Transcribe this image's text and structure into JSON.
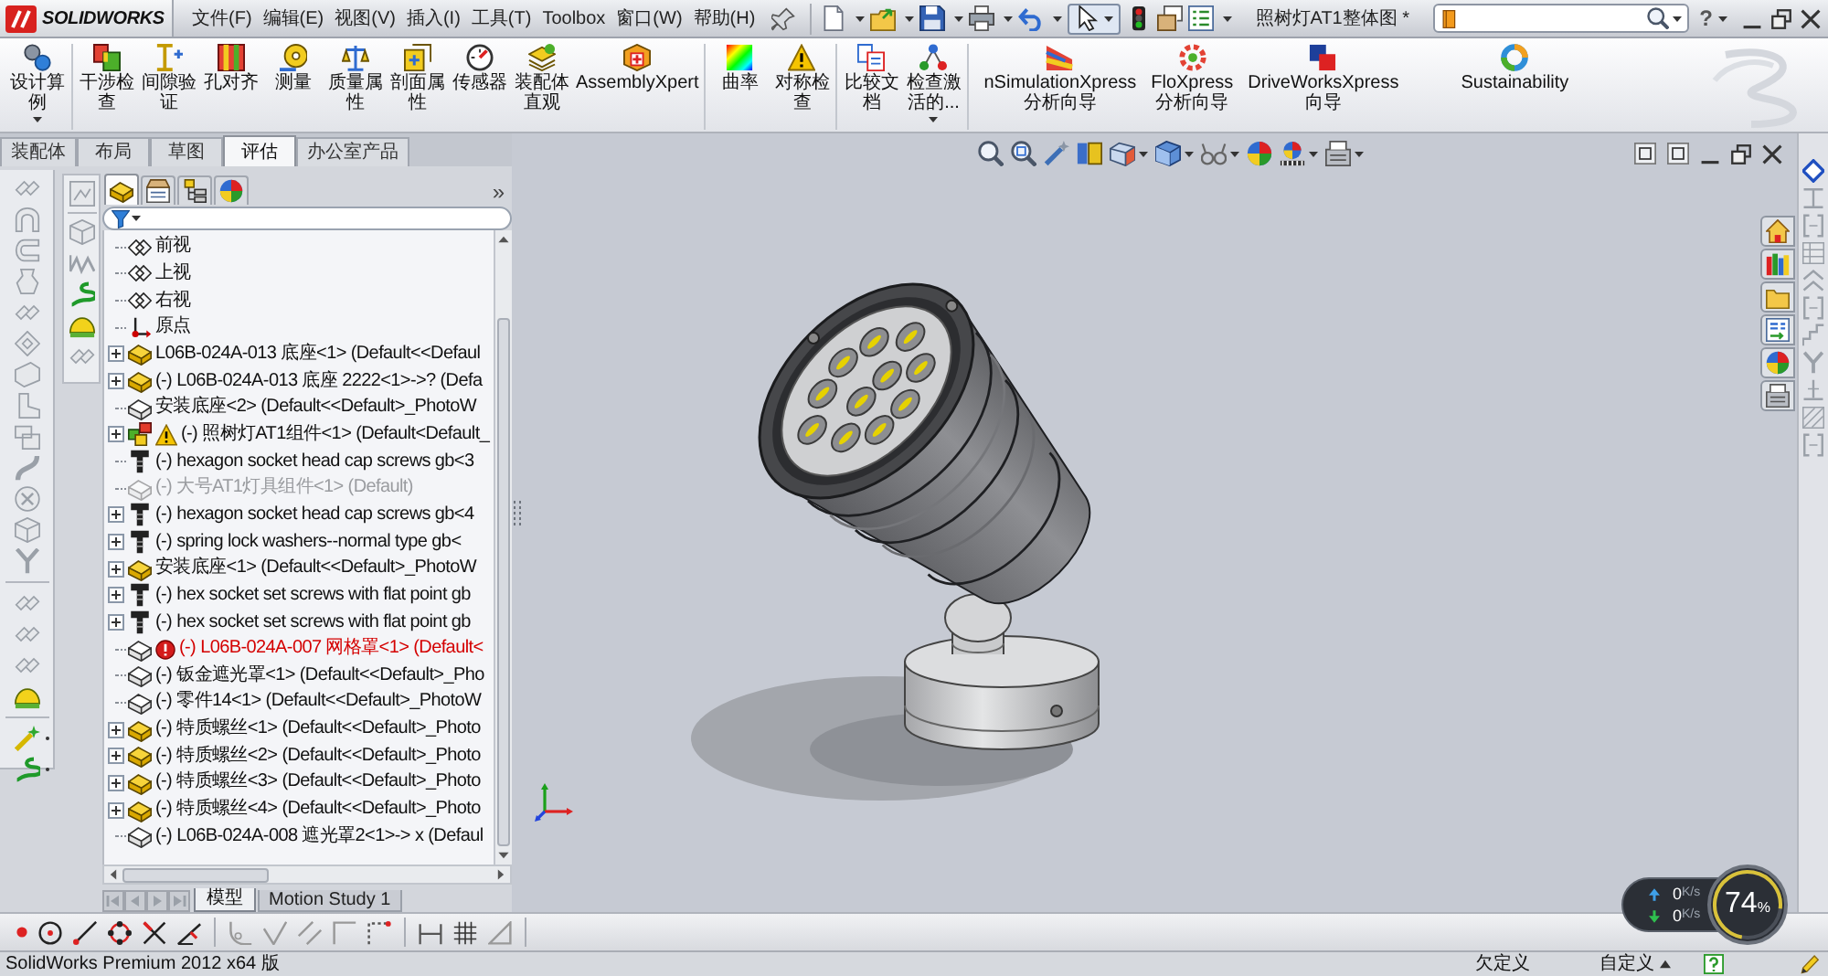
{
  "title_bar": {
    "logo": "SOLIDWORKS",
    "menu": [
      "文件(F)",
      "编辑(E)",
      "视图(V)",
      "插入(I)",
      "工具(T)",
      "Toolbox",
      "窗口(W)",
      "帮助(H)"
    ],
    "select_pressed": true,
    "document_title": "照树灯AT1整体图 *",
    "help": "?"
  },
  "ribbon": {
    "groups": [
      {
        "buttons": [
          {
            "label": "设计算例",
            "dropdown": true
          }
        ]
      },
      {
        "buttons": [
          {
            "label": "干涉检查",
            "dropdown": false
          },
          {
            "label": "间隙验证",
            "dropdown": false
          },
          {
            "label": "孔对齐",
            "dropdown": false
          },
          {
            "label": "测量",
            "dropdown": false
          },
          {
            "label": "质量属性",
            "dropdown": false
          },
          {
            "label": "剖面属性",
            "dropdown": false
          },
          {
            "label": "传感器",
            "dropdown": false
          },
          {
            "label": "装配体直观",
            "dropdown": false
          },
          {
            "label": "AssemblyXpert",
            "dropdown": false
          }
        ]
      },
      {
        "buttons": [
          {
            "label": "曲率",
            "dropdown": false
          },
          {
            "label": "对称检查",
            "dropdown": false
          }
        ]
      },
      {
        "buttons": [
          {
            "label": "比较文档",
            "dropdown": false
          },
          {
            "label": "检查激活的...",
            "dropdown": true
          }
        ]
      },
      {
        "buttons": [
          {
            "label": "nSimulationXpress 分析向导",
            "dropdown": false
          },
          {
            "label": "FloXpress 分析向导",
            "dropdown": false
          },
          {
            "label": "DriveWorksXpress 向导",
            "dropdown": false
          },
          {
            "label": "Sustainability",
            "dropdown": false
          }
        ]
      }
    ]
  },
  "tabs": [
    {
      "label": "装配体",
      "selected": false
    },
    {
      "label": "布局",
      "selected": false
    },
    {
      "label": "草图",
      "selected": false
    },
    {
      "label": "评估",
      "selected": true
    },
    {
      "label": "办公室产品",
      "selected": false
    }
  ],
  "feature_tree": {
    "panel_tabs": [
      {
        "selected": true
      },
      {
        "selected": false
      },
      {
        "selected": false
      },
      {
        "selected": false
      }
    ],
    "expand_toggle": "»",
    "items": [
      {
        "text": "前视",
        "kind": "plane",
        "expandable": false,
        "warning": false,
        "error": false,
        "suppressed": false
      },
      {
        "text": "上视",
        "kind": "plane",
        "expandable": false,
        "warning": false,
        "error": false,
        "suppressed": false
      },
      {
        "text": "右视",
        "kind": "plane",
        "expandable": false,
        "warning": false,
        "error": false,
        "suppressed": false
      },
      {
        "text": "原点",
        "kind": "origin",
        "expandable": false,
        "warning": false,
        "error": false,
        "suppressed": false
      },
      {
        "text": "L06B-024A-013 底座<1> (Default<<Defaul",
        "kind": "assembly",
        "expandable": true,
        "warning": false,
        "error": false,
        "suppressed": false
      },
      {
        "text": "(-) L06B-024A-013 底座 2222<1>->? (Defa",
        "kind": "assembly",
        "expandable": true,
        "warning": false,
        "error": false,
        "suppressed": false
      },
      {
        "text": "安装底座<2> (Default<<Default>_PhotoW",
        "kind": "part",
        "expandable": false,
        "warning": false,
        "error": false,
        "suppressed": false
      },
      {
        "text": "(-) 照树灯AT1组件<1> (Default<Default_",
        "kind": "multi_assembly",
        "expandable": true,
        "warning": true,
        "error": false,
        "suppressed": false
      },
      {
        "text": "(-) hexagon socket head cap screws gb<3",
        "kind": "screw",
        "expandable": false,
        "warning": false,
        "error": false,
        "suppressed": false
      },
      {
        "text": "(-) 大号AT1灯具组件<1> (Default)",
        "kind": "part",
        "expandable": false,
        "warning": false,
        "error": false,
        "suppressed": true
      },
      {
        "text": "(-) hexagon socket head cap screws gb<4",
        "kind": "screw",
        "expandable": true,
        "warning": false,
        "error": false,
        "suppressed": false
      },
      {
        "text": "(-) spring lock washers--normal type gb<",
        "kind": "screw",
        "expandable": true,
        "warning": false,
        "error": false,
        "suppressed": false
      },
      {
        "text": "安装底座<1> (Default<<Default>_PhotoW",
        "kind": "assembly",
        "expandable": true,
        "warning": false,
        "error": false,
        "suppressed": false
      },
      {
        "text": "(-) hex socket set screws with flat point gb",
        "kind": "screw",
        "expandable": true,
        "warning": false,
        "error": false,
        "suppressed": false
      },
      {
        "text": "(-) hex socket set screws with flat point gb",
        "kind": "screw",
        "expandable": true,
        "warning": false,
        "error": false,
        "suppressed": false
      },
      {
        "text": "(-) L06B-024A-007 网格罩<1> (Default<",
        "kind": "part",
        "expandable": false,
        "warning": false,
        "error": true,
        "suppressed": false
      },
      {
        "text": "(-) 钣金遮光罩<1> (Default<<Default>_Pho",
        "kind": "part",
        "expandable": false,
        "warning": false,
        "error": false,
        "suppressed": false
      },
      {
        "text": "(-) 零件14<1> (Default<<Default>_PhotoW",
        "kind": "part",
        "expandable": false,
        "warning": false,
        "error": false,
        "suppressed": false
      },
      {
        "text": "(-) 特质螺丝<1> (Default<<Default>_Photo",
        "kind": "assembly",
        "expandable": true,
        "warning": false,
        "error": false,
        "suppressed": false
      },
      {
        "text": "(-) 特质螺丝<2> (Default<<Default>_Photo",
        "kind": "assembly",
        "expandable": true,
        "warning": false,
        "error": false,
        "suppressed": false
      },
      {
        "text": "(-) 特质螺丝<3> (Default<<Default>_Photo",
        "kind": "assembly",
        "expandable": true,
        "warning": false,
        "error": false,
        "suppressed": false
      },
      {
        "text": "(-) 特质螺丝<4> (Default<<Default>_Photo",
        "kind": "assembly",
        "expandable": true,
        "warning": false,
        "error": false,
        "suppressed": false
      },
      {
        "text": "(-) L06B-024A-008 遮光罩2<1>-> x (Defaul",
        "kind": "part",
        "expandable": false,
        "warning": false,
        "error": false,
        "suppressed": false
      }
    ]
  },
  "bottom_tabs": [
    {
      "label": "模型",
      "selected": true
    },
    {
      "label": "Motion Study 1",
      "selected": false
    }
  ],
  "status_bar": {
    "product": "SolidWorks Premium 2012 x64 版",
    "sketch_state": "欠定义",
    "units": "自定义"
  },
  "network_widget": {
    "upload_rate": "0",
    "upload_unit": "K/s",
    "download_rate": "0",
    "download_unit": "K/s",
    "usage": "74",
    "usage_unit": "%",
    "level": 0.74
  }
}
